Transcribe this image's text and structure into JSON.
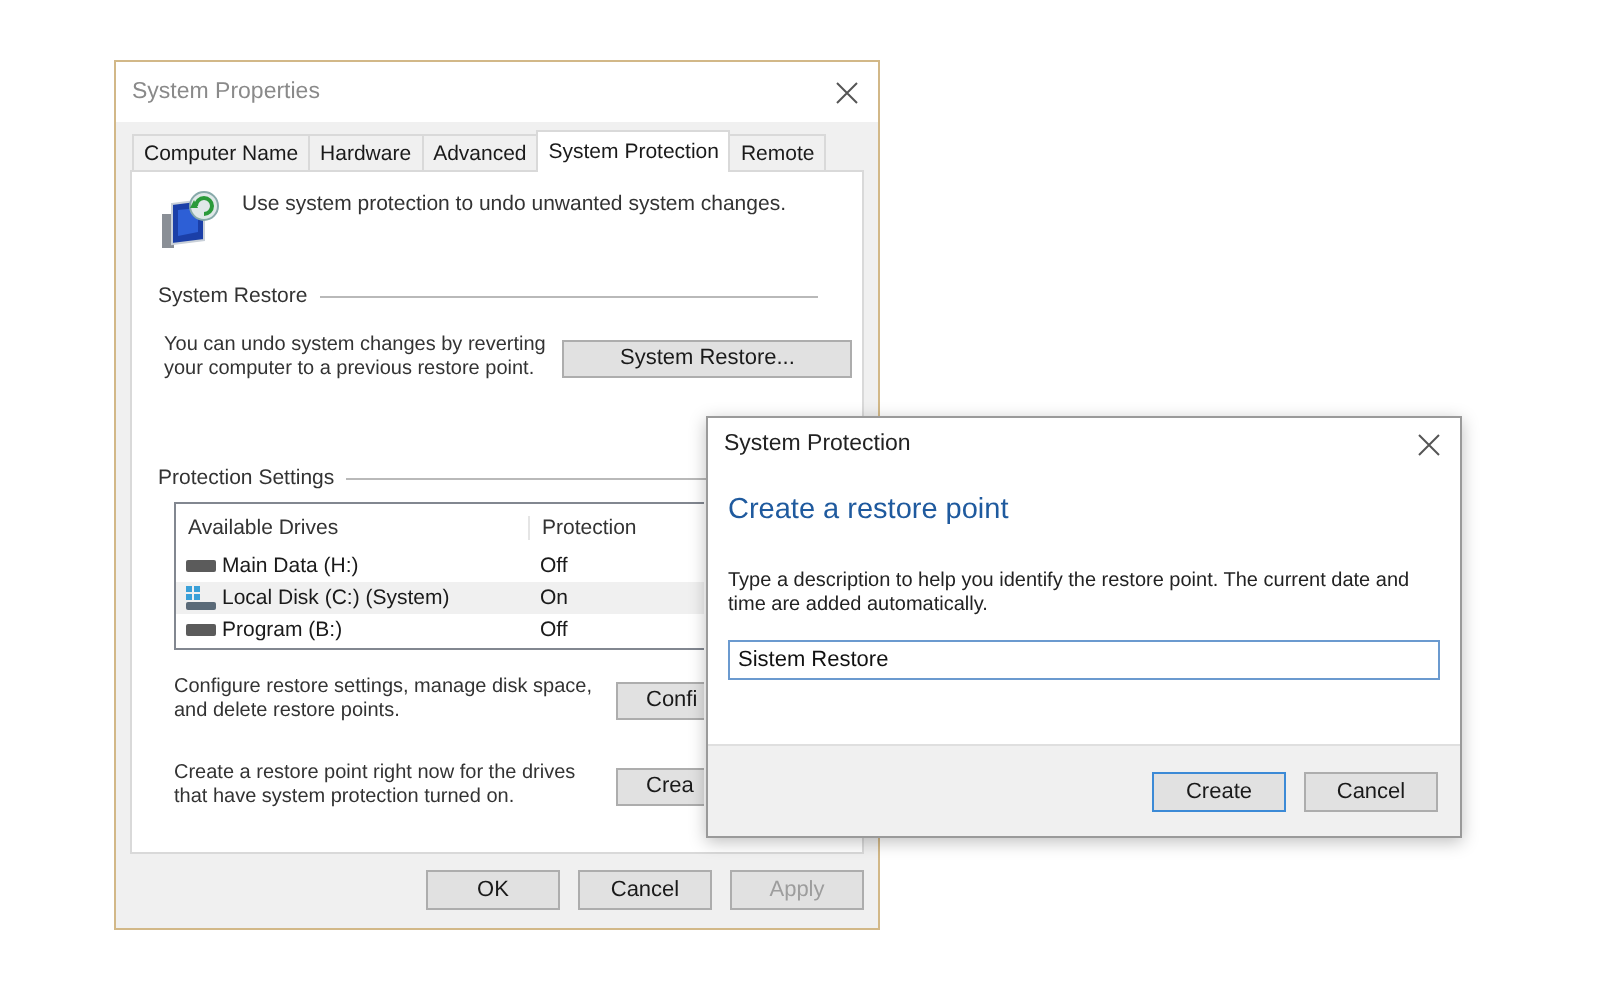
{
  "main_window": {
    "title": "System Properties",
    "tabs": [
      {
        "label": "Computer Name",
        "selected": false
      },
      {
        "label": "Hardware",
        "selected": false
      },
      {
        "label": "Advanced",
        "selected": false
      },
      {
        "label": "System Protection",
        "selected": true
      },
      {
        "label": "Remote",
        "selected": false
      }
    ],
    "intro": "Use system protection to undo unwanted system changes.",
    "system_restore": {
      "heading": "System Restore",
      "description": "You can undo system changes by reverting your computer to a previous restore point.",
      "button": "System Restore..."
    },
    "protection_settings": {
      "heading": "Protection Settings",
      "columns": [
        "Available Drives",
        "Protection"
      ],
      "drives": [
        {
          "name": "Main Data (H:)",
          "protection": "Off",
          "kind": "disk",
          "selected": false
        },
        {
          "name": "Local Disk (C:) (System)",
          "protection": "On",
          "kind": "system",
          "selected": true
        },
        {
          "name": "Program (B:)",
          "protection": "Off",
          "kind": "disk",
          "selected": false
        }
      ],
      "actions": [
        {
          "text": "Configure restore settings, manage disk space, and delete restore points.",
          "button": "Confi"
        },
        {
          "text": "Create a restore point right now for the drives that have system protection turned on.",
          "button": "Crea"
        }
      ]
    },
    "buttons": [
      {
        "label": "OK",
        "disabled": false
      },
      {
        "label": "Cancel",
        "disabled": false
      },
      {
        "label": "Apply",
        "disabled": true
      }
    ]
  },
  "dialog": {
    "title": "System Protection",
    "heading": "Create a restore point",
    "text": "Type a description to help you identify the restore point. The current date and time are added automatically.",
    "value": "Sistem Restore",
    "buttons": [
      {
        "label": "Create",
        "focused": true
      },
      {
        "label": "Cancel",
        "focused": false
      }
    ]
  }
}
